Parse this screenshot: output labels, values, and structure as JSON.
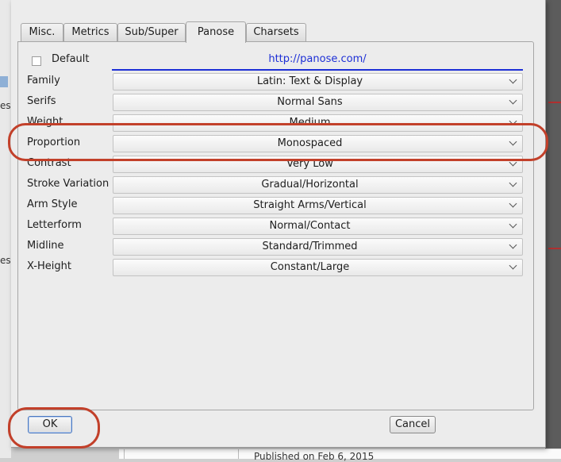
{
  "background": {
    "left_fragments": [
      "es",
      "es"
    ],
    "bottom_text": "Published on Feb 6, 2015"
  },
  "tabs": [
    {
      "label": "Misc.",
      "active": false
    },
    {
      "label": "Metrics",
      "active": false
    },
    {
      "label": "Sub/Super",
      "active": false
    },
    {
      "label": "Panose",
      "active": true
    },
    {
      "label": "Charsets",
      "active": false
    }
  ],
  "panose": {
    "default_label": "Default",
    "default_checked": false,
    "url": "http://panose.com/",
    "rows": [
      {
        "label": "Family",
        "value": "Latin: Text & Display"
      },
      {
        "label": "Serifs",
        "value": "Normal Sans"
      },
      {
        "label": "Weight",
        "value": "Medium"
      },
      {
        "label": "Proportion",
        "value": "Monospaced"
      },
      {
        "label": "Contrast",
        "value": "Very Low"
      },
      {
        "label": "Stroke Variation",
        "value": "Gradual/Horizontal"
      },
      {
        "label": "Arm Style",
        "value": "Straight Arms/Vertical"
      },
      {
        "label": "Letterform",
        "value": "Normal/Contact"
      },
      {
        "label": "Midline",
        "value": "Standard/Trimmed"
      },
      {
        "label": "X-Height",
        "value": "Constant/Large"
      }
    ]
  },
  "buttons": {
    "ok": "OK",
    "cancel": "Cancel"
  },
  "colors": {
    "highlight": "#c2402a",
    "link": "#1d2fd6"
  },
  "icons": {
    "dropdown": "chevron-down-icon"
  }
}
